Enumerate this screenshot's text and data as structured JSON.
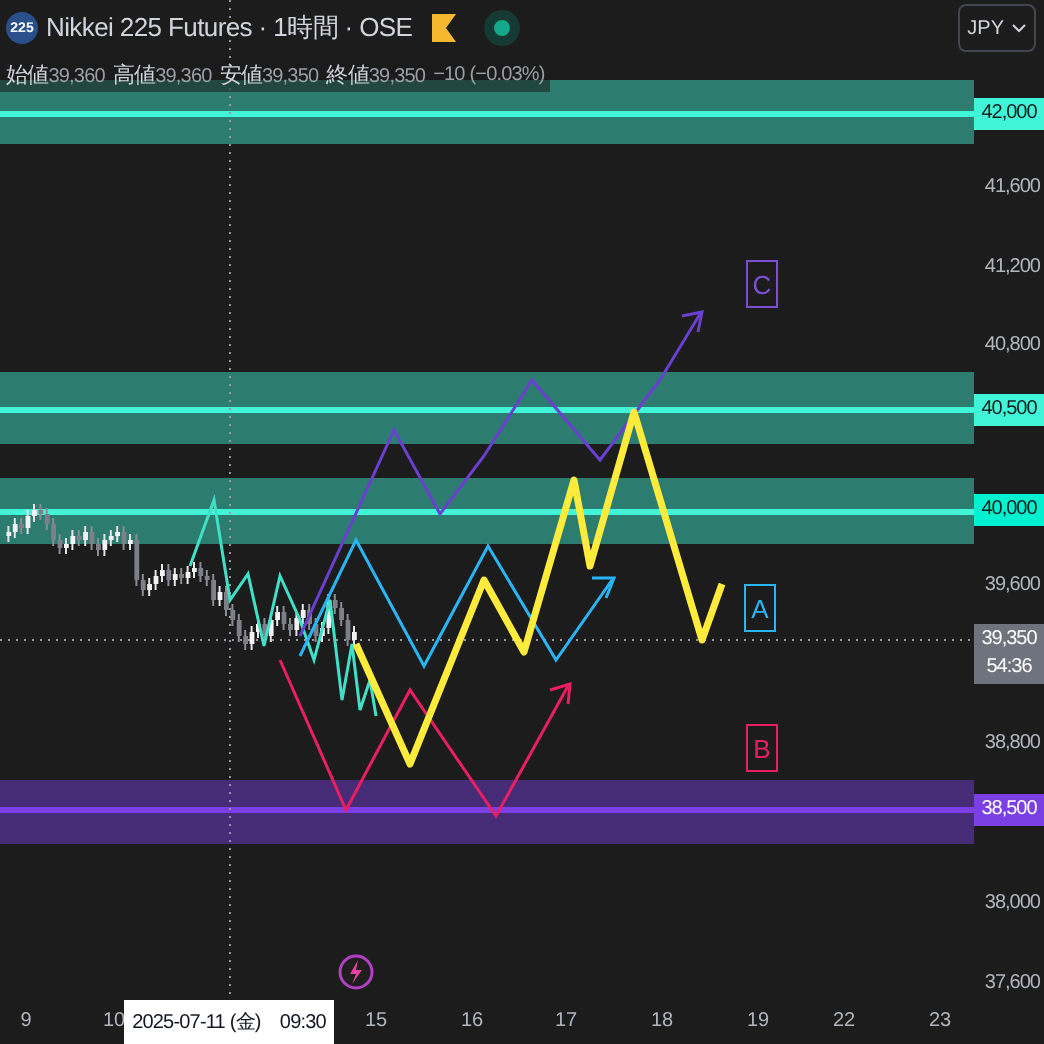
{
  "header": {
    "badge": "225",
    "title": "Nikkei 225 Futures · 1時間 · OSE",
    "currency": "JPY"
  },
  "ohlc": [
    {
      "label": "始値",
      "value": "39,360"
    },
    {
      "label": "高値",
      "value": "39,360"
    },
    {
      "label": "安値",
      "value": "39,350"
    },
    {
      "label": "終値",
      "value": "39,350"
    }
  ],
  "change": "−10 (−0.03%)",
  "zones": [
    {
      "color": "#40f5d8"
    },
    {
      "color": "#40f5d8"
    },
    {
      "color": "#40f5d8"
    },
    {
      "color": "#7b3fe4"
    }
  ],
  "wave_labels": [
    {
      "text": "C",
      "color": "#7e4fd6"
    },
    {
      "text": "A",
      "color": "#29b6f6"
    },
    {
      "text": "B",
      "color": "#e91e63"
    }
  ],
  "price_axis": [
    {
      "kind": "tag",
      "text": "42,000",
      "color": "#40f5d8"
    },
    {
      "kind": "plain",
      "text": "41,600"
    },
    {
      "kind": "plain",
      "text": "41,200"
    },
    {
      "kind": "plain",
      "text": "40,800"
    },
    {
      "kind": "tag",
      "text": "40,500",
      "color": "#40f5d8"
    },
    {
      "kind": "tag",
      "text": "40,000",
      "color": "#00f0d0"
    },
    {
      "kind": "plain",
      "text": "39,600"
    },
    {
      "kind": "tag",
      "text": "39,350",
      "color": "#6f737d",
      "countdown": "54:36"
    },
    {
      "kind": "plain",
      "text": "38,800"
    },
    {
      "kind": "tag",
      "text": "38,500",
      "color": "#7b3fe4"
    },
    {
      "kind": "plain",
      "text": "38,000"
    },
    {
      "kind": "plain",
      "text": "37,600"
    }
  ],
  "time_axis": [
    "9",
    "10",
    "15",
    "16",
    "17",
    "18",
    "19",
    "22",
    "23"
  ],
  "crosshair_time": "2025-07-11 (金)　09:30"
}
